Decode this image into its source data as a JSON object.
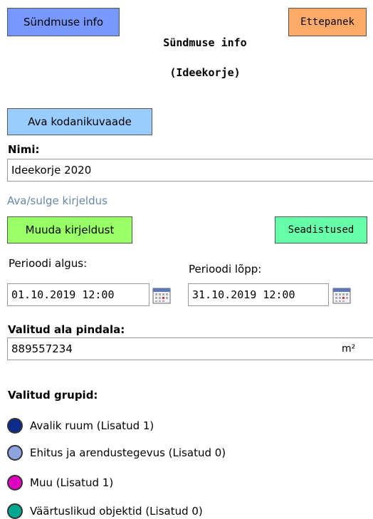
{
  "header": {
    "info_button": "Sündmuse info",
    "proposal_button": "Ettepanek",
    "title_line1": "Sündmuse info",
    "title_line2": "(Ideekorje)"
  },
  "citizen_view_button": "Ava kodanikuvaade",
  "name": {
    "label": "Nimi:",
    "value": "Ideekorje 2020"
  },
  "description_toggle": "Ava/sulge kirjeldus",
  "edit_description_button": "Muuda kirjeldust",
  "settings_button": "Seadistused",
  "period": {
    "start_label": "Perioodi algus:",
    "start_value": "01.10.2019 12:00",
    "end_label": "Perioodi lõpp:",
    "end_value": "31.10.2019 12:00"
  },
  "area": {
    "label": "Valitud ala pindala:",
    "value": "889557234",
    "unit": "m²"
  },
  "groups": {
    "label": "Valitud grupid:",
    "items": [
      {
        "label": "Avalik ruum (Lisatud 1)",
        "color": "#0d2a8f"
      },
      {
        "label": "Ehitus ja arendustegevus (Lisatud 0)",
        "color": "#8ea4e0"
      },
      {
        "label": "Muu (Lisatud 1)",
        "color": "#e000c0"
      },
      {
        "label": "Väärtuslikud objektid (Lisatud 0)",
        "color": "#00a890"
      }
    ]
  },
  "icons": {
    "calendar": "calendar-icon"
  }
}
